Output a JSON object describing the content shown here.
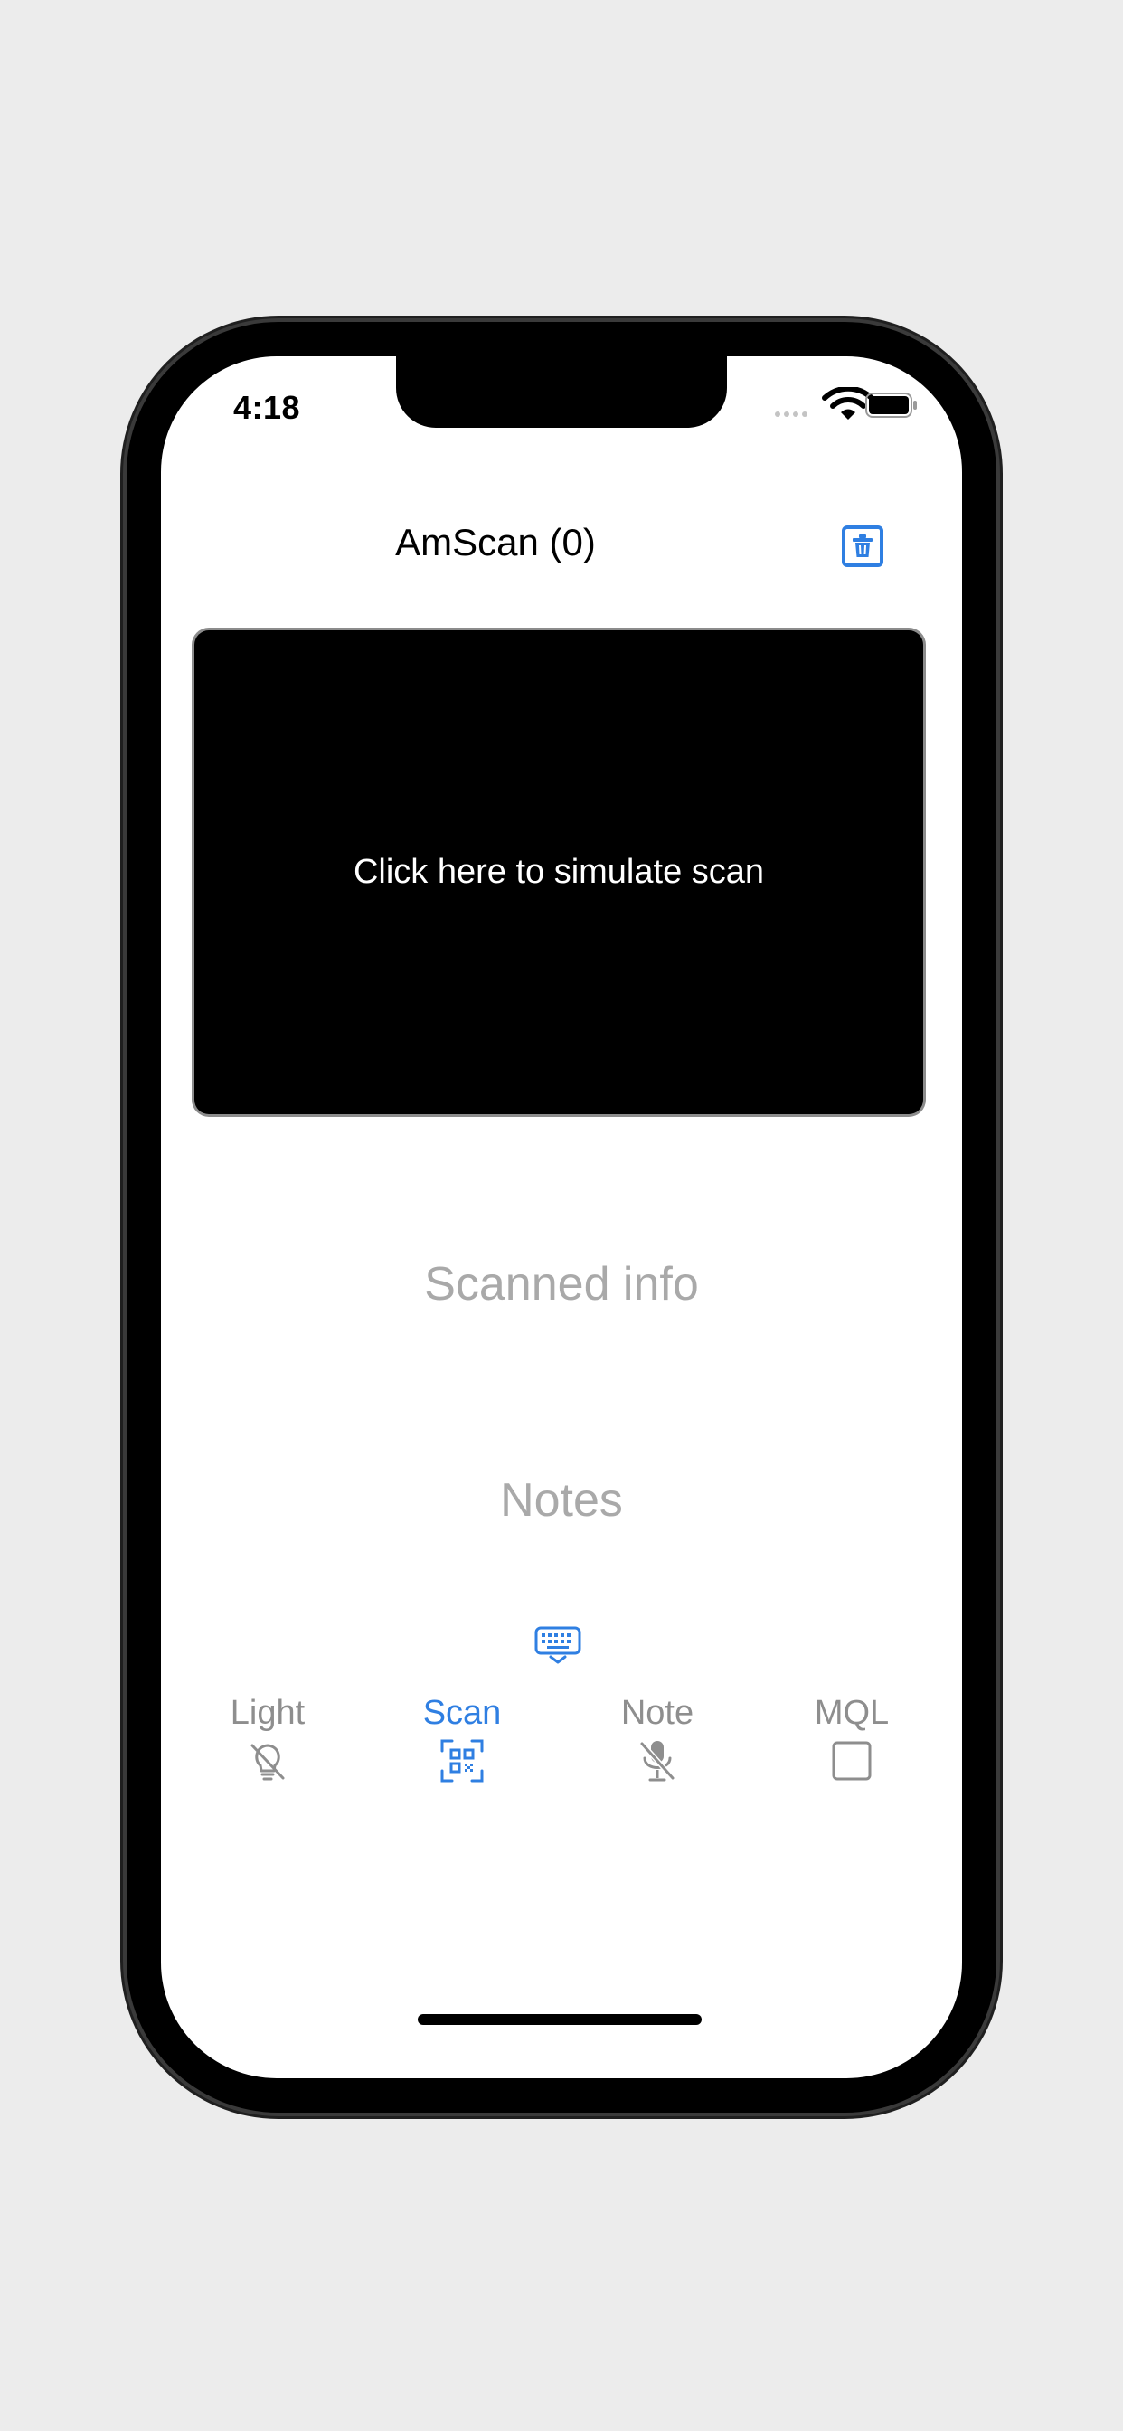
{
  "status_bar": {
    "time": "4:18"
  },
  "nav": {
    "title": "AmScan (0)"
  },
  "scanner": {
    "placeholder": "Click here to simulate scan"
  },
  "fields": {
    "scanned_info_placeholder": "Scanned info",
    "notes_placeholder": "Notes"
  },
  "tabs": [
    {
      "label": "Light",
      "icon": "lightbulb-slash-icon",
      "active": false
    },
    {
      "label": "Scan",
      "icon": "qrcode-viewfinder-icon",
      "active": true
    },
    {
      "label": "Note",
      "icon": "mic-slash-icon",
      "active": false
    },
    {
      "label": "MQL",
      "icon": "checkbox-empty-icon",
      "active": false
    }
  ],
  "colors": {
    "accent": "#2f7fe2",
    "inactive": "#8e8e8e",
    "placeholder": "#a9a9a9",
    "scan_area_background": "#000000"
  }
}
